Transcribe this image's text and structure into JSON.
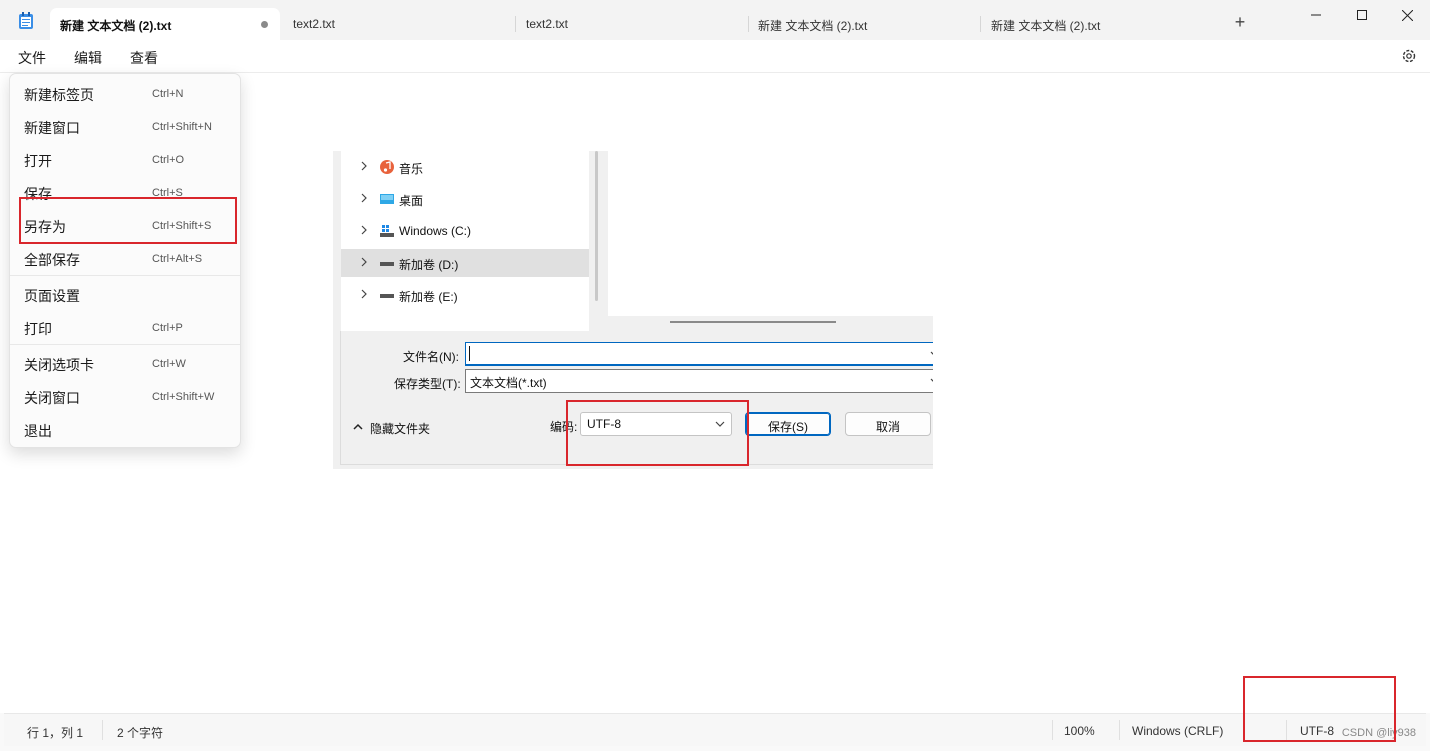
{
  "tabs": [
    {
      "label": "新建 文本文档 (2).txt",
      "active": true,
      "unsaved": true
    },
    {
      "label": "text2.txt",
      "active": false
    },
    {
      "label": "text2.txt",
      "active": false
    },
    {
      "label": "新建 文本文档 (2).txt",
      "active": false
    },
    {
      "label": "新建 文本文档 (2).txt",
      "active": false
    }
  ],
  "new_tab_label": "+",
  "menubar": {
    "file": "文件",
    "edit": "编辑",
    "view": "查看"
  },
  "file_menu": {
    "items": [
      {
        "label": "新建标签页",
        "shortcut": "Ctrl+N"
      },
      {
        "label": "新建窗口",
        "shortcut": "Ctrl+Shift+N"
      },
      {
        "label": "打开",
        "shortcut": "Ctrl+O"
      },
      {
        "label": "保存",
        "shortcut": "Ctrl+S"
      },
      {
        "label": "另存为",
        "shortcut": "Ctrl+Shift+S"
      },
      {
        "label": "全部保存",
        "shortcut": "Ctrl+Alt+S"
      },
      {
        "label": "页面设置",
        "shortcut": ""
      },
      {
        "label": "打印",
        "shortcut": "Ctrl+P"
      },
      {
        "label": "关闭选项卡",
        "shortcut": "Ctrl+W"
      },
      {
        "label": "关闭窗口",
        "shortcut": "Ctrl+Shift+W"
      },
      {
        "label": "退出",
        "shortcut": ""
      }
    ]
  },
  "save_dialog": {
    "nav": [
      {
        "label": "音乐",
        "icon": "music-icon"
      },
      {
        "label": "桌面",
        "icon": "desktop-icon"
      },
      {
        "label": "Windows (C:)",
        "icon": "windows-drive-icon"
      },
      {
        "label": "新加卷 (D:)",
        "icon": "drive-icon",
        "selected": true
      },
      {
        "label": "新加卷 (E:)",
        "icon": "drive-icon"
      }
    ],
    "filename_label": "文件名(N):",
    "filename_value": "",
    "filetype_label": "保存类型(T):",
    "filetype_value": "文本文档(*.txt)",
    "hide_folders": "隐藏文件夹",
    "encoding_label": "编码:",
    "encoding_value": "UTF-8",
    "save_button": "保存(S)",
    "cancel_button": "取消"
  },
  "statusbar": {
    "position": "行 1，列 1",
    "char_count": "2 个字符",
    "zoom": "100%",
    "line_ending": "Windows (CRLF)",
    "encoding": "UTF-8"
  },
  "watermark": "CSDN @liy938",
  "colors": {
    "highlight_red": "#d9262c",
    "accent_blue": "#0067c0"
  }
}
